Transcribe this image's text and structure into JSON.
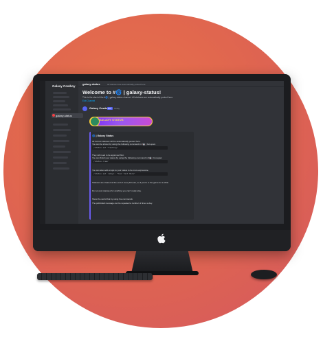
{
  "server": {
    "name": "Galaxy Cowboy"
  },
  "sidebar": {
    "active_channel": "galaxy-status"
  },
  "topbar": {
    "channel": "galaxy-status",
    "topic": "All statuses are automatically posted here"
  },
  "welcome": {
    "title": "Welcome to #🌀 | galaxy-status!",
    "subtitle": "This is the start of the #🌀 | galaxy-status channel. All statuses are automatically posted here.",
    "edit_label": "Edit Channel"
  },
  "message": {
    "author": "Galaxy Cowboy",
    "bot_tag": "BOT",
    "time": "Today"
  },
  "banner": {
    "text": "GALAXY STATUS"
  },
  "embed": {
    "title": "🌀 | Galaxy Status",
    "lines": [
      "All current statuses will be automatically posted here.",
      "You can be shown by using the following command in #🤖 | bot-spam",
      "They will need to be approved first.",
      "You can finish your status by using the following command in #🤖 | bot-spam",
      "You can also add emojis to your status to be more expressive.",
      "Statuses are cleared at the end of every 8 hours, so if you're in the game for a while",
      "Do not post statuses for anything you can't really play.",
      "Show the world that by using the commands"
    ],
    "code": [
      "/status set  \"Testing\"",
      "/status clear",
      "/status set :emoji: \"Your Text Here\""
    ],
    "footer": "The published message can be repeated a number of times a day."
  }
}
